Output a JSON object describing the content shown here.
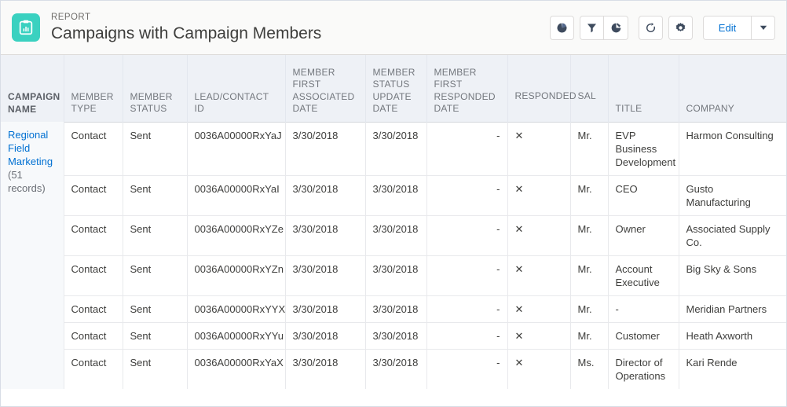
{
  "header": {
    "icon_name": "report-clipboard-chart-icon",
    "icon_color": "#3ad1c0",
    "eyebrow": "REPORT",
    "title": "Campaigns with Campaign Members",
    "actions": {
      "chart_label": "Toggle Chart",
      "filter_label": "Filters",
      "conditional_format_label": "Conditional Formatting",
      "refresh_label": "Refresh",
      "settings_label": "Report Settings",
      "edit_label": "Edit",
      "edit_menu_label": "Edit Menu"
    },
    "accent_link_color": "#0070d2"
  },
  "table": {
    "columns": [
      {
        "label": "CAMPAIGN NAME",
        "sorted": true
      },
      {
        "label": "MEMBER TYPE",
        "sorted": false
      },
      {
        "label": "MEMBER STATUS",
        "sorted": false
      },
      {
        "label": "LEAD/CONTACT ID",
        "sorted": false
      },
      {
        "label": "MEMBER FIRST ASSOCIATED DATE",
        "sorted": false
      },
      {
        "label": "MEMBER STATUS UPDATE DATE",
        "sorted": false
      },
      {
        "label": "MEMBER FIRST RESPONDED DATE",
        "sorted": false
      },
      {
        "label": "RESPONDED",
        "sorted": false
      },
      {
        "label": "SAL",
        "sorted": false
      },
      {
        "label": "TITLE",
        "sorted": false
      },
      {
        "label": "COMPANY",
        "sorted": false
      }
    ],
    "group": {
      "name": "Regional Field Marketing",
      "record_count": "(51 records)"
    },
    "rows": [
      {
        "member_type": "Contact",
        "member_status": "Sent",
        "lead_contact_id": "0036A00000RxYaJ",
        "first_associated_date": "3/30/2018",
        "status_update_date": "3/30/2018",
        "first_responded_date": "-",
        "responded": "✕",
        "sal": "Mr.",
        "title": "EVP Business Development",
        "company": "Harmon Consulting"
      },
      {
        "member_type": "Contact",
        "member_status": "Sent",
        "lead_contact_id": "0036A00000RxYaI",
        "first_associated_date": "3/30/2018",
        "status_update_date": "3/30/2018",
        "first_responded_date": "-",
        "responded": "✕",
        "sal": "Mr.",
        "title": "CEO",
        "company": "Gusto Manufacturing"
      },
      {
        "member_type": "Contact",
        "member_status": "Sent",
        "lead_contact_id": "0036A00000RxYZe",
        "first_associated_date": "3/30/2018",
        "status_update_date": "3/30/2018",
        "first_responded_date": "-",
        "responded": "✕",
        "sal": "Mr.",
        "title": "Owner",
        "company": "Associated Supply Co."
      },
      {
        "member_type": "Contact",
        "member_status": "Sent",
        "lead_contact_id": "0036A00000RxYZn",
        "first_associated_date": "3/30/2018",
        "status_update_date": "3/30/2018",
        "first_responded_date": "-",
        "responded": "✕",
        "sal": "Mr.",
        "title": "Account Executive",
        "company": "Big Sky & Sons"
      },
      {
        "member_type": "Contact",
        "member_status": "Sent",
        "lead_contact_id": "0036A00000RxYYX",
        "first_associated_date": "3/30/2018",
        "status_update_date": "3/30/2018",
        "first_responded_date": "-",
        "responded": "✕",
        "sal": "Mr.",
        "title": "-",
        "company": "Meridian Partners"
      },
      {
        "member_type": "Contact",
        "member_status": "Sent",
        "lead_contact_id": "0036A00000RxYYu",
        "first_associated_date": "3/30/2018",
        "status_update_date": "3/30/2018",
        "first_responded_date": "-",
        "responded": "✕",
        "sal": "Mr.",
        "title": "Customer",
        "company": "Heath Axworth"
      },
      {
        "member_type": "Contact",
        "member_status": "Sent",
        "lead_contact_id": "0036A00000RxYaX",
        "first_associated_date": "3/30/2018",
        "status_update_date": "3/30/2018",
        "first_responded_date": "-",
        "responded": "✕",
        "sal": "Ms.",
        "title": "Director of Operations",
        "company": "Kari Rende"
      }
    ]
  }
}
